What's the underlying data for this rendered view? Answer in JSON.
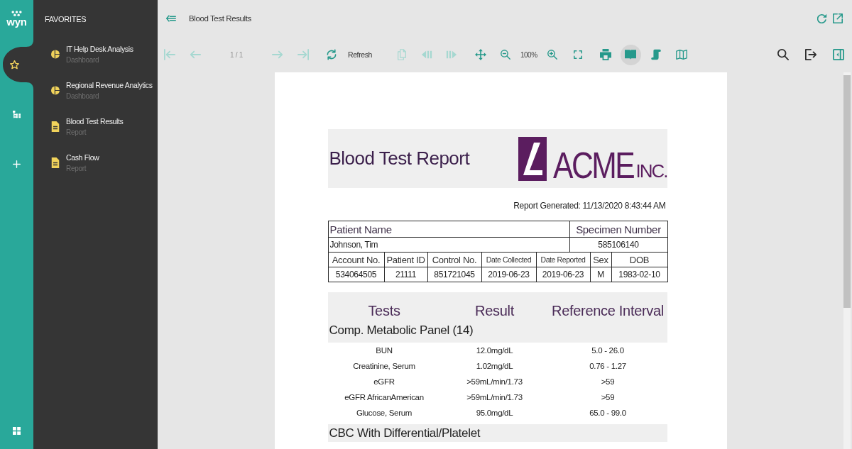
{
  "rail": {
    "logo": "wyn",
    "items": [
      {
        "kind": "favorites",
        "selected": true
      },
      {
        "kind": "catalog",
        "selected": false
      },
      {
        "kind": "create",
        "selected": false
      }
    ]
  },
  "sidebar": {
    "title": "FAVORITES",
    "items": [
      {
        "kind": "dashboard",
        "name": "IT Help Desk Analysis",
        "type": "Dashboard"
      },
      {
        "kind": "dashboard",
        "name": "Regional Revenue Analytics",
        "type": "Dashboard"
      },
      {
        "kind": "report",
        "name": "Blood Test Results",
        "type": "Report"
      },
      {
        "kind": "report",
        "name": "Cash Flow",
        "type": "Report"
      }
    ]
  },
  "header": {
    "title": "Blood Test Results",
    "actions": [
      {
        "kind": "reload"
      },
      {
        "kind": "external"
      }
    ]
  },
  "toolbar": {
    "navigation": [
      {
        "kind": "first",
        "disabled": true
      },
      {
        "kind": "previous",
        "disabled": true
      },
      {
        "kind": "page",
        "text": "1 / 1",
        "disabled": true
      },
      {
        "kind": "next",
        "disabled": true
      },
      {
        "kind": "last",
        "disabled": true
      }
    ],
    "refresh": {
      "label": "Refresh"
    },
    "tools": [
      {
        "kind": "export",
        "disabled": true
      },
      {
        "kind": "backward",
        "disabled": true
      },
      {
        "kind": "forward",
        "disabled": true
      },
      {
        "kind": "pan",
        "disabled": false
      },
      {
        "kind": "shrink",
        "disabled": false
      },
      {
        "kind": "zoom",
        "text": "100%",
        "disabled": false
      },
      {
        "kind": "enlarge",
        "disabled": false
      },
      {
        "kind": "fit",
        "disabled": false
      },
      {
        "kind": "print",
        "disabled": false
      }
    ],
    "view_modes": [
      {
        "kind": "book",
        "selected": true
      },
      {
        "kind": "scroll",
        "selected": false
      },
      {
        "kind": "map",
        "selected": false
      }
    ],
    "actions": [
      {
        "kind": "search"
      },
      {
        "kind": "exit"
      },
      {
        "kind": "panel"
      }
    ]
  },
  "report": {
    "title": "Blood Test Report",
    "logo": {
      "text": "ACME",
      "suffix": "INC."
    },
    "generated": "Report Generated: 11/13/2020 8:43:44 AM",
    "patient": {
      "name_label": "Patient Name",
      "specimen_label": "Specimen Number",
      "name": "Johnson, Tim",
      "specimen": "585106140"
    },
    "details": {
      "columns": [
        "Account No.",
        "Patient ID",
        "Control No.",
        "Date Collected",
        "Date Reported",
        "Sex",
        "DOB"
      ],
      "values": [
        "534064505",
        "21111",
        "851721045",
        "2019-06-23",
        "2019-06-23",
        "M",
        "1983-02-10"
      ]
    },
    "tests": {
      "columns": [
        "Tests",
        "Result",
        "Reference Interval"
      ],
      "panels": [
        {
          "name": "Comp. Metabolic Panel (14)",
          "rows": [
            [
              "BUN",
              "12.0mg/dL",
              "5.0 - 26.0"
            ],
            [
              "Creatinine, Serum",
              "1.02mg/dL",
              "0.76 - 1.27"
            ],
            [
              "eGFR",
              ">59mL/min/1.73",
              ">59"
            ],
            [
              "eGFR AfricanAmerican",
              ">59mL/min/1.73",
              ">59"
            ],
            [
              "Glucose, Serum",
              "95.0mg/dL",
              "65.0 - 99.0"
            ]
          ]
        },
        {
          "name": "CBC With Differential/Platelet"
        }
      ]
    }
  }
}
